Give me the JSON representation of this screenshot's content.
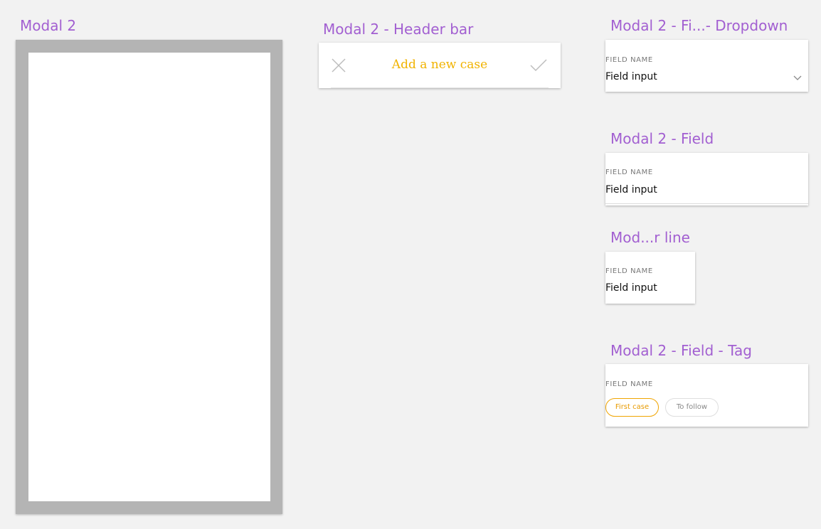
{
  "colors": {
    "canvas": "#f2f2f2",
    "artboard_title": "#a25fd1",
    "accent": "#f1b300",
    "tag_accent": "#f0a400"
  },
  "artboards": {
    "modal": "Modal 2",
    "header_bar": "Modal 2 - Header bar",
    "dropdown": "Modal 2 - Fi...- Dropdown",
    "field": "Modal 2 - Field",
    "short_field": "Mod...r line",
    "tag": "Modal 2 - Field - Tag"
  },
  "header_bar": {
    "title": "Add a new case",
    "close_icon": "close-icon",
    "confirm_icon": "check-icon"
  },
  "dropdown": {
    "label": "FIELD NAME",
    "value": "Field input",
    "icon": "chevron-down-icon"
  },
  "field": {
    "label": "FIELD NAME",
    "value": "Field input"
  },
  "short_field": {
    "label": "FIELD NAME",
    "value": "Field input"
  },
  "tag_field": {
    "label": "FIELD NAME",
    "tags": [
      {
        "label": "First case",
        "selected": true
      },
      {
        "label": "To follow",
        "selected": false
      }
    ]
  }
}
